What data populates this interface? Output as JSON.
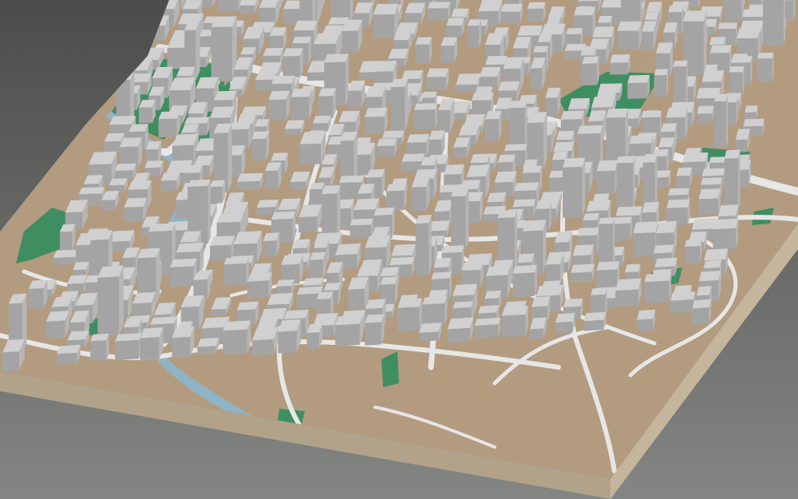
{
  "scene": {
    "kind": "3d-city-block-model",
    "label_visible": false,
    "colors": {
      "background_top": "#4b4d4b",
      "background_bottom": "#7f827f",
      "base_top": "#b39b80",
      "base_side_front": "#b1a289",
      "base_side_right": "#c4b59c",
      "building_top": "#d0d0d0",
      "building_side": "#b6b6b6",
      "building_front": "#a4a4a4",
      "road": "#e4e4e4",
      "park": "#3f8e62",
      "water": "#8fb4c6"
    }
  }
}
